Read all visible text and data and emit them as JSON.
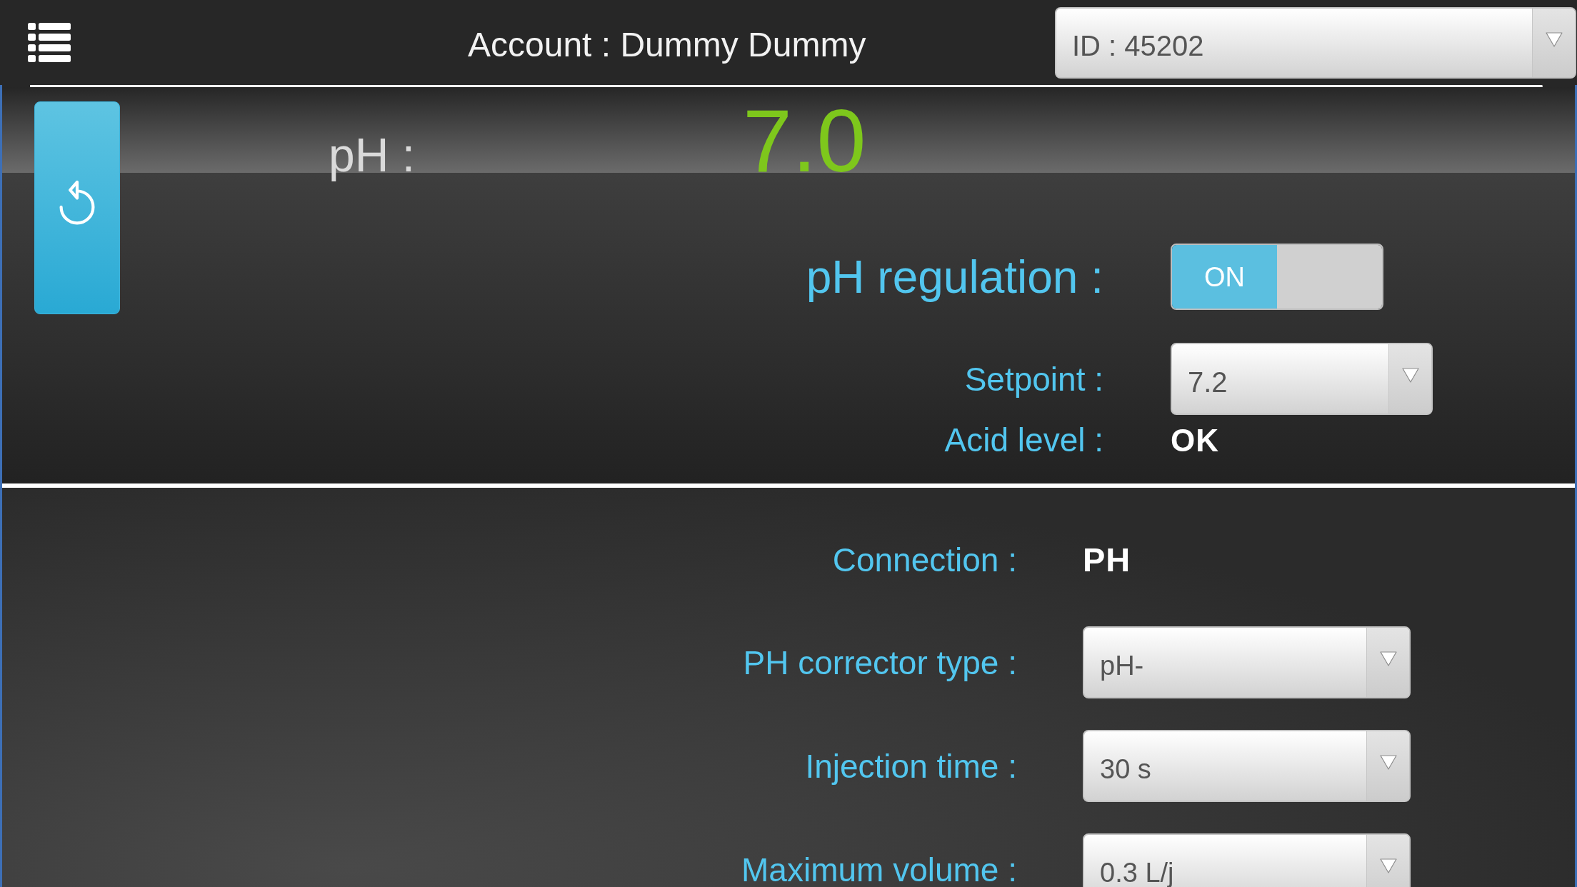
{
  "header": {
    "account": "Account : Dummy Dummy",
    "id_select": "ID : 45202"
  },
  "reading": {
    "label": "pH :",
    "value": "7.0"
  },
  "regulation_panel": {
    "rows": [
      {
        "kind": "toggle",
        "label": "pH regulation :",
        "on": true,
        "state_text": "ON"
      },
      {
        "kind": "select",
        "label": "Setpoint :",
        "value": "7.2"
      },
      {
        "kind": "text",
        "label": "Acid level :",
        "value": "OK"
      }
    ]
  },
  "settings": {
    "rows": [
      {
        "kind": "text",
        "label": "Connection :",
        "value": "PH"
      },
      {
        "kind": "select",
        "label": "PH corrector type :",
        "value": "pH-"
      },
      {
        "kind": "select",
        "label": "Injection time :",
        "value": "30 s"
      },
      {
        "kind": "select",
        "label": "Maximum volume :",
        "value": "0.3 L/j"
      }
    ]
  }
}
